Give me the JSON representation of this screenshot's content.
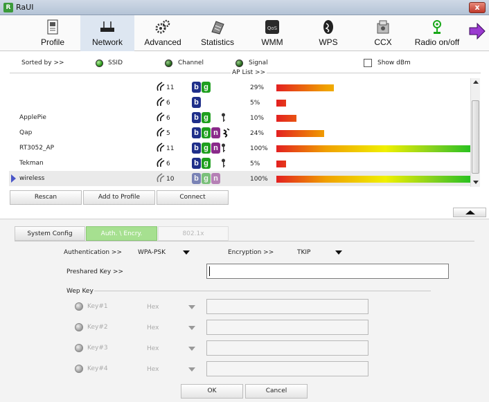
{
  "window": {
    "title": "RaUI",
    "close_label": "x"
  },
  "toolbar": {
    "items": [
      {
        "label": "Profile",
        "icon": "profile-icon"
      },
      {
        "label": "Network",
        "icon": "network-icon",
        "active": true
      },
      {
        "label": "Advanced",
        "icon": "gears-icon"
      },
      {
        "label": "Statistics",
        "icon": "statistics-icon"
      },
      {
        "label": "WMM",
        "icon": "qos-icon"
      },
      {
        "label": "WPS",
        "icon": "wps-icon"
      },
      {
        "label": "CCX",
        "icon": "ccx-icon"
      },
      {
        "label": "Radio on/off",
        "icon": "radio-antenna-icon"
      }
    ]
  },
  "sort": {
    "label": "Sorted by >>",
    "options": [
      {
        "label": "SSID",
        "selected": true
      },
      {
        "label": "Channel",
        "selected": false
      },
      {
        "label": "Signal",
        "selected": false
      }
    ],
    "show_dbm": {
      "label": "Show dBm",
      "checked": false
    }
  },
  "ap_list": {
    "title": "AP List >>",
    "rows": [
      {
        "ssid": "",
        "channel": "11",
        "modes": [
          "b",
          "g"
        ],
        "secure": false,
        "wps": false,
        "signal": "29%",
        "signal_value": 29
      },
      {
        "ssid": "",
        "channel": "6",
        "modes": [
          "b"
        ],
        "secure": false,
        "wps": false,
        "signal": "5%",
        "signal_value": 5
      },
      {
        "ssid": "ApplePie",
        "channel": "6",
        "modes": [
          "b",
          "g"
        ],
        "secure": true,
        "wps": false,
        "signal": "10%",
        "signal_value": 10
      },
      {
        "ssid": "Qap",
        "channel": "5",
        "modes": [
          "b",
          "g",
          "n"
        ],
        "secure": false,
        "wps": true,
        "signal": "24%",
        "signal_value": 24
      },
      {
        "ssid": "RT3052_AP",
        "channel": "11",
        "modes": [
          "b",
          "g",
          "n"
        ],
        "secure": true,
        "wps": false,
        "signal": "100%",
        "signal_value": 100
      },
      {
        "ssid": "Tekman",
        "channel": "6",
        "modes": [
          "b",
          "g"
        ],
        "secure": true,
        "wps": false,
        "signal": "5%",
        "signal_value": 5
      },
      {
        "ssid": "wireless",
        "channel": "10",
        "modes": [
          "b",
          "g",
          "n"
        ],
        "secure": false,
        "wps": false,
        "signal": "100%",
        "signal_value": 100,
        "selected": true
      }
    ]
  },
  "actions": {
    "rescan": "Rescan",
    "add_to_profile": "Add to Profile",
    "connect": "Connect"
  },
  "tabs": [
    {
      "label": "System Config",
      "state": "inactive"
    },
    {
      "label": "Auth. \\ Encry.",
      "state": "active"
    },
    {
      "label": "802.1x",
      "state": "disabled"
    }
  ],
  "auth": {
    "auth_label": "Authentication >>",
    "auth_value": "WPA-PSK",
    "enc_label": "Encryption >>",
    "enc_value": "TKIP",
    "psk_label": "Preshared Key >>",
    "psk_value": ""
  },
  "wep": {
    "title": "Wep Key",
    "keys": [
      {
        "label": "Key#1",
        "format": "Hex"
      },
      {
        "label": "Key#2",
        "format": "Hex"
      },
      {
        "label": "Key#3",
        "format": "Hex"
      },
      {
        "label": "Key#4",
        "format": "Hex"
      }
    ]
  },
  "footer": {
    "ok": "OK",
    "cancel": "Cancel"
  },
  "colors": {
    "active_tab": "#a6e090",
    "toolbar_active": "#dde6f1",
    "badge_b": "#1f2f8a",
    "badge_g": "#1f9f1f",
    "badge_n": "#8a2a8a"
  }
}
